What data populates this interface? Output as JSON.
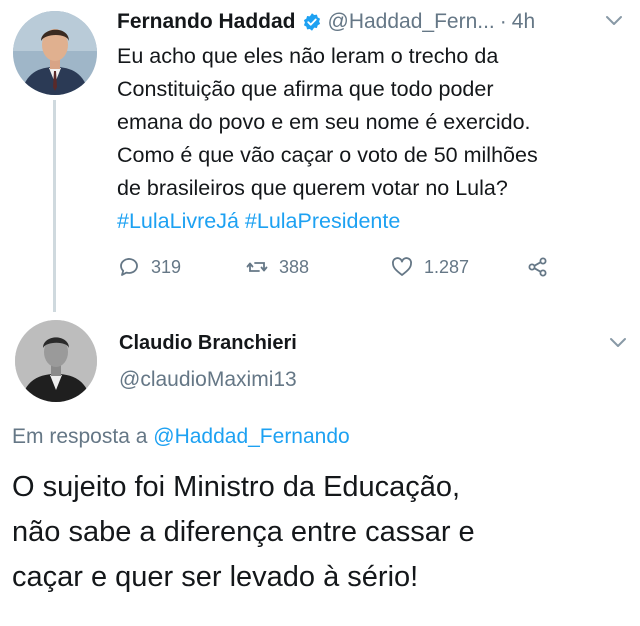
{
  "tweet": {
    "author_name": "Fernando Haddad",
    "author_handle": "@Haddad_Fern...",
    "separator": "·",
    "time": "4h",
    "body_lines": [
      "Eu acho que eles não leram o trecho da",
      "Constituição que afirma que todo poder",
      "emana do povo e em seu nome é exercido.",
      "Como é que vão caçar o voto de 50 milhões",
      "de brasileiros que querem votar no Lula?"
    ],
    "hashtags": [
      "#LulaLivreJá",
      "#LulaPresidente"
    ],
    "actions": {
      "replies": "319",
      "retweets": "388",
      "likes": "1.287"
    }
  },
  "reply": {
    "author_name": "Claudio Branchieri",
    "author_handle": "@claudioMaximi13",
    "replying_to_prefix": "Em resposta a",
    "replying_to_handle": "@Haddad_Fernando",
    "body_lines": [
      "O sujeito foi Ministro da Educação,",
      "não sabe a diferença entre cassar e",
      "caçar e quer ser levado à sério!"
    ]
  },
  "colors": {
    "accent": "#1da1f2",
    "secondary_text": "#657786",
    "primary_text": "#14171a",
    "thread_line": "#cfd9de"
  },
  "icons": {
    "verified": "verified-badge-icon",
    "reply": "reply-bubble-icon",
    "retweet": "retweet-icon",
    "like": "heart-icon",
    "share": "share-icon",
    "more": "chevron-down-icon"
  }
}
